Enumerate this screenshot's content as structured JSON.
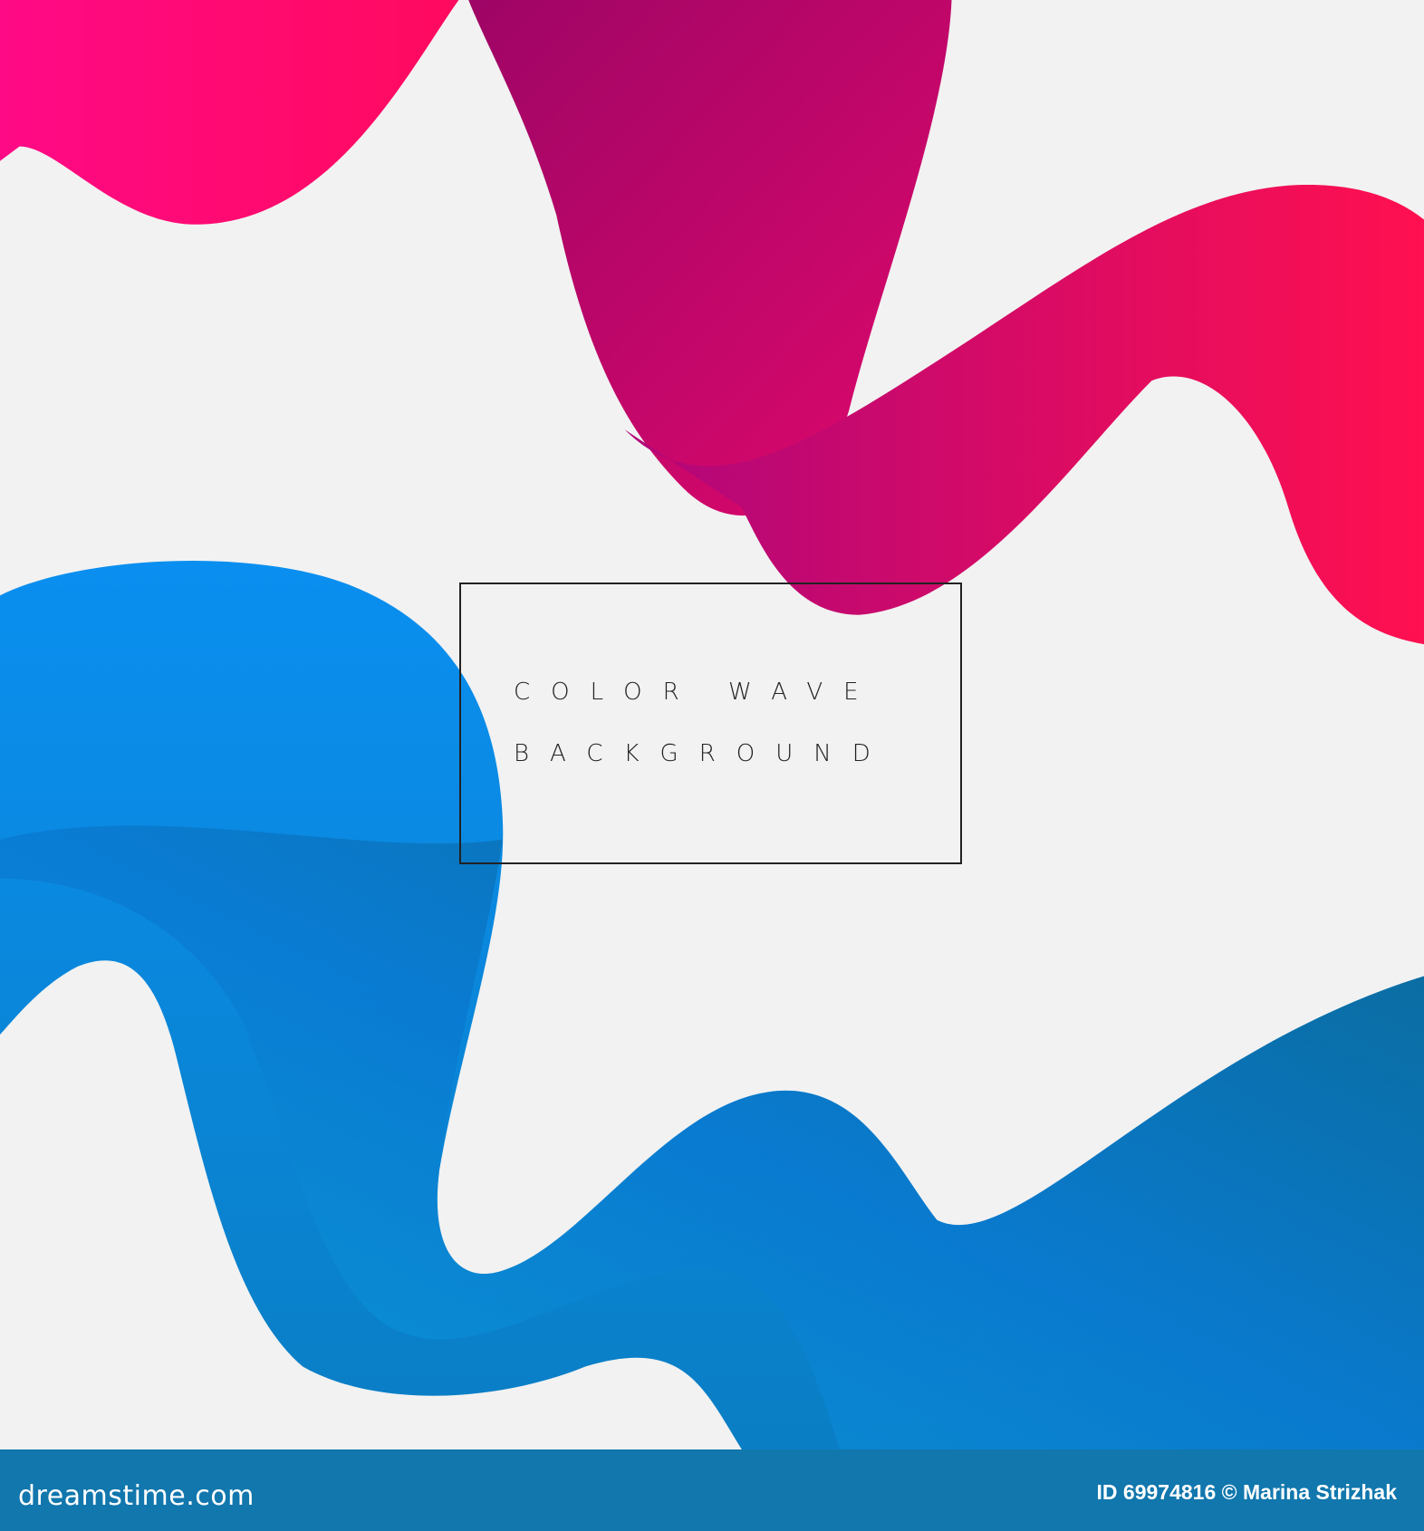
{
  "artwork": {
    "title_line1": "COLOR WAVE",
    "title_line2": "BACKGROUND",
    "colors": {
      "background": "#f2f2f2",
      "pink": "#ff0a6e",
      "magenta": "#b5066e",
      "blue": "#0a8fe0",
      "teal": "#0c6e88"
    }
  },
  "watermark": {
    "text": "dreamstime"
  },
  "footer": {
    "logo": "dreamstime.com",
    "credit": "ID 69974816 © Marina Strizhak",
    "color": "#1177ad"
  }
}
